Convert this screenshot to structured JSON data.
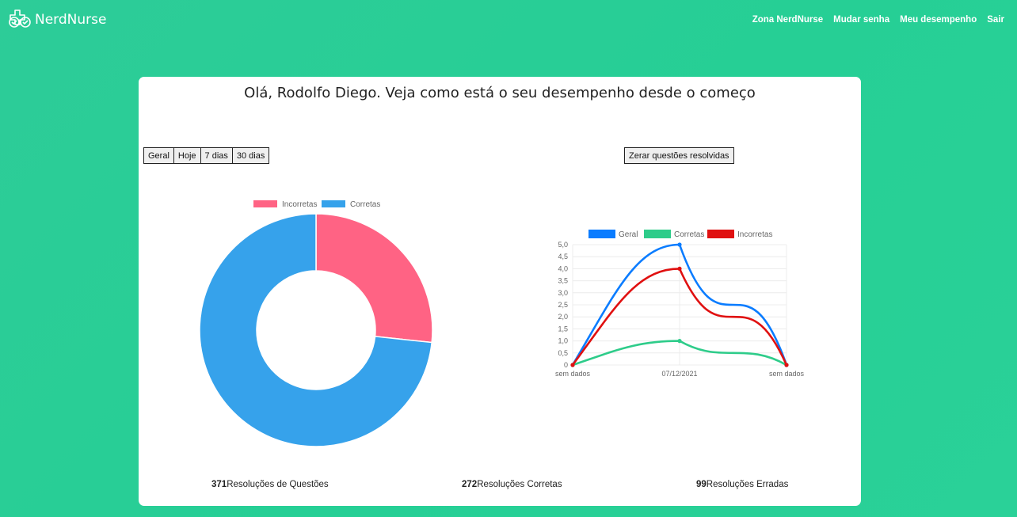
{
  "app": {
    "brand": "NerdNurse"
  },
  "nav": {
    "items": [
      "Zona NerdNurse",
      "Mudar senha",
      "Meu desempenho",
      "Sair"
    ]
  },
  "header": {
    "title": "Olá, Rodolfo Diego. Veja como está o seu desempenho desde o começo"
  },
  "filters": [
    "Geral",
    "Hoje",
    "7 dias",
    "30 dias"
  ],
  "reset_label": "Zerar questões resolvidas",
  "stats": {
    "total": {
      "value": "371",
      "label": "Resoluções de Questões"
    },
    "correct": {
      "value": "272",
      "label": "Resoluções Corretas"
    },
    "wrong": {
      "value": "99",
      "label": "Resoluções Erradas"
    }
  },
  "colors": {
    "brand_bg": "#28cf96",
    "incorrect": "#ff6384",
    "correct_pie": "#36a2eb",
    "geral": "#0a7cff",
    "corretas_line": "#2ecc8a",
    "incorretas_line": "#e01010"
  },
  "chart_data": [
    {
      "type": "pie",
      "subtype": "doughnut",
      "legend_position": "top",
      "labels": [
        "Incorretas",
        "Corretas"
      ],
      "values": [
        99,
        272
      ],
      "colors": [
        "#ff6384",
        "#36a2eb"
      ]
    },
    {
      "type": "line",
      "legend_position": "top",
      "categories": [
        "sem dados",
        "07/12/2021",
        "sem dados"
      ],
      "series": [
        {
          "name": "Geral",
          "values": [
            0,
            5,
            0
          ],
          "color": "#0a7cff"
        },
        {
          "name": "Corretas",
          "values": [
            0,
            1,
            0
          ],
          "color": "#2ecc8a"
        },
        {
          "name": "Incorretas",
          "values": [
            0,
            4,
            0
          ],
          "color": "#e01010"
        }
      ],
      "ylim": [
        0,
        5
      ],
      "yticks": [
        "0",
        "0,5",
        "1,0",
        "1,5",
        "2,0",
        "2,5",
        "3,0",
        "3,5",
        "4,0",
        "4,5",
        "5,0"
      ],
      "grid": true
    }
  ]
}
